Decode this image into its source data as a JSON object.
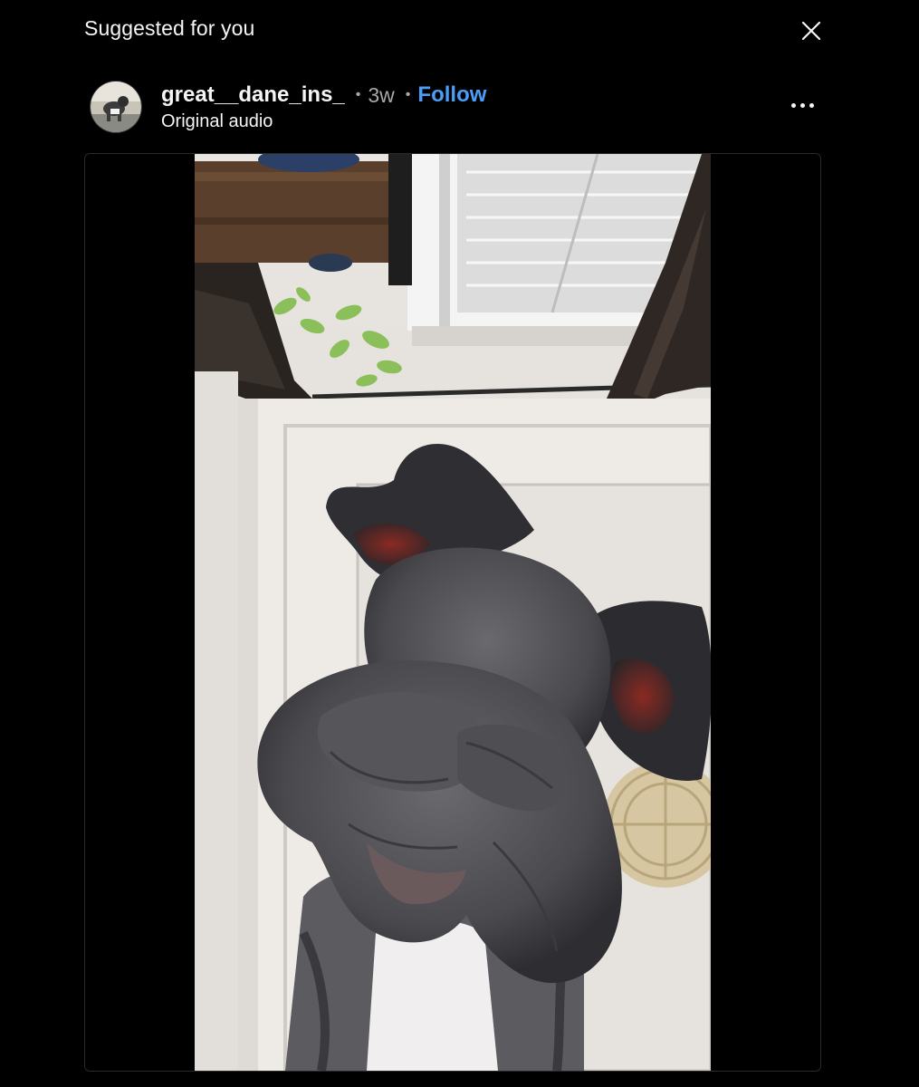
{
  "dialog": {
    "title": "Suggested for you",
    "close_icon": "close-icon"
  },
  "post": {
    "username": "great__dane_ins_",
    "separator": "•",
    "age": "3w",
    "follow_label": "Follow",
    "audio_label": "Original audio",
    "more_icon": "more-options-icon"
  },
  "video": {
    "subject": "great-dane-photo",
    "mute_icon": "speaker-muted-icon"
  },
  "colors": {
    "background": "#000000",
    "text": "#f5f5f5",
    "secondary_text": "#a8a8a8",
    "follow_link": "#4b9ef8",
    "mute_button": "#262626"
  }
}
